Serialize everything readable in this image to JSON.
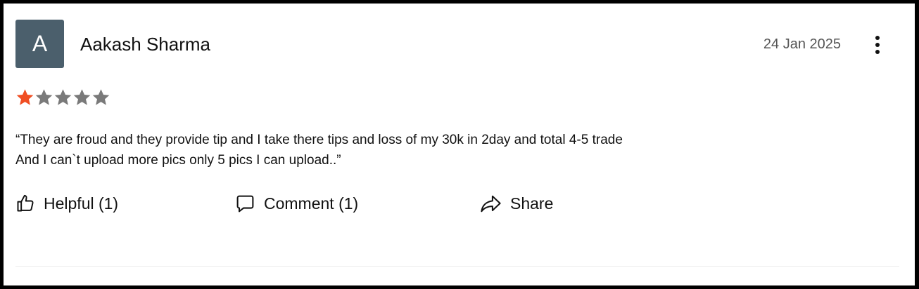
{
  "review": {
    "avatar_initial": "A",
    "reviewer_name": "Aakash Sharma",
    "date": "24 Jan 2025",
    "rating": 1,
    "rating_max": 5,
    "text_lines": [
      "“They are froud and they provide tip and I take there tips and loss of my 30k in 2day and total 4-5 trade",
      "And I can`t upload more pics only 5 pics I can upload..”"
    ]
  },
  "actions": {
    "helpful_label": "Helpful (1)",
    "comment_label": "Comment (1)",
    "share_label": "Share"
  },
  "icons": {
    "menu": "more-vertical-icon",
    "helpful": "thumbs-up-icon",
    "comment": "comment-bubble-icon",
    "share": "share-arrow-icon",
    "star": "star-icon"
  },
  "colors": {
    "avatar_bg": "#4b5f6c",
    "star_filled": "#f04e23",
    "star_empty": "#7a7a7a",
    "text": "#111111",
    "date": "#555555"
  }
}
